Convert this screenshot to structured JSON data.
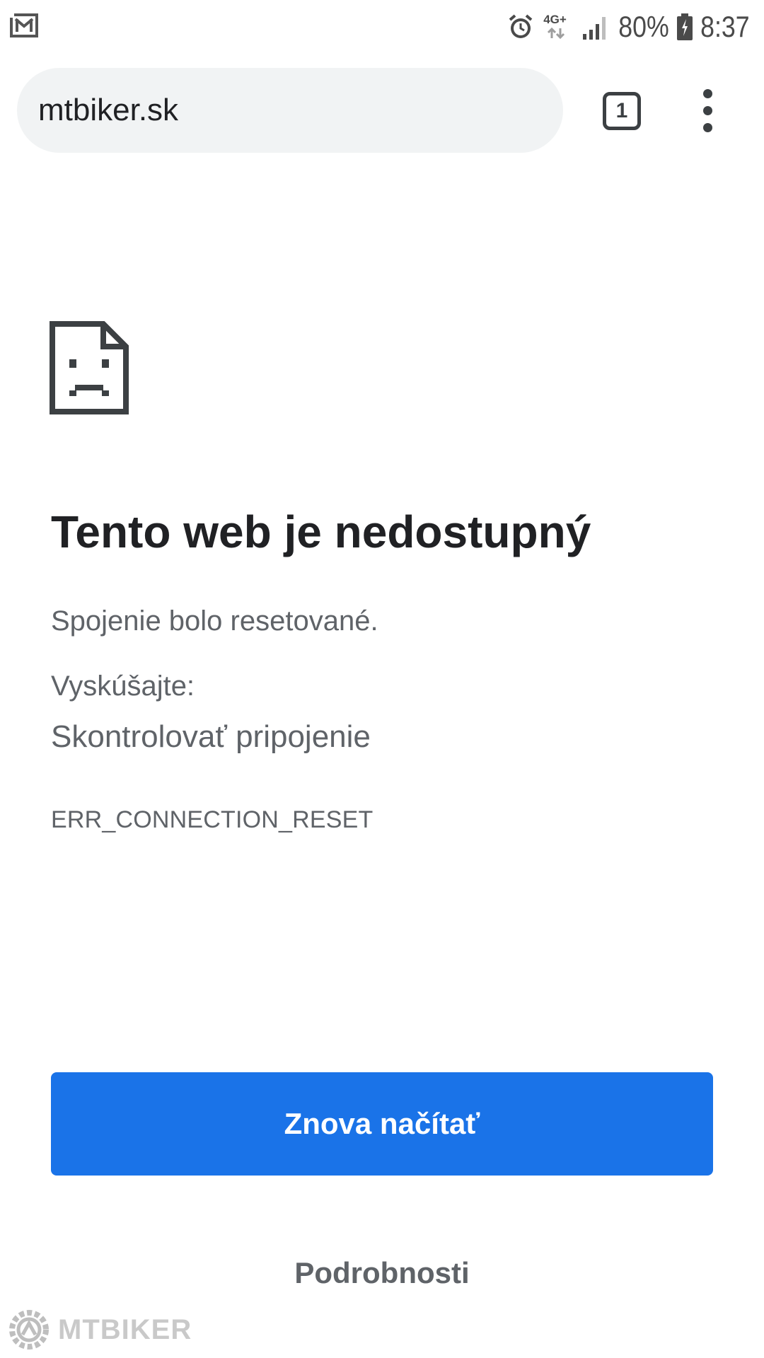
{
  "status_bar": {
    "left_icon": "mail-icon",
    "network_type": "4G+",
    "battery_percent": "80%",
    "time": "8:37",
    "icons": [
      "alarm-icon",
      "network-arrows-icon",
      "signal-icon",
      "battery-icon"
    ]
  },
  "toolbar": {
    "url": "mtbiker.sk",
    "tab_count": "1",
    "menu_icon": "more-vert-icon"
  },
  "error_page": {
    "icon": "sad-page-icon",
    "title": "Tento web je nedostupný",
    "description": "Spojenie bolo resetované.",
    "suggestions_heading": "Vyskúšajte:",
    "suggestions": [
      "Skontrolovať pripojenie"
    ],
    "error_code": "ERR_CONNECTION_RESET",
    "reload_label": "Znova načítať",
    "details_label": "Podrobnosti"
  },
  "watermark": {
    "text": "MTBIKER"
  },
  "colors": {
    "accent": "#1a73e8",
    "title_text": "#202124",
    "body_text": "#5f6368",
    "omnibox_bg": "#f1f3f4"
  }
}
